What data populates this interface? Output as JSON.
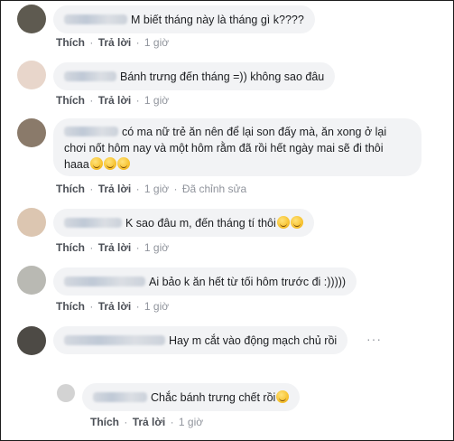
{
  "actions": {
    "like": "Thích",
    "reply": "Trả lời",
    "separator": "·"
  },
  "comments": [
    {
      "text": "M biết tháng này là tháng gì k????",
      "time": "1 giờ",
      "edited": ""
    },
    {
      "text": "Bánh trưng đến tháng =)) không sao đâu",
      "time": "1 giờ",
      "edited": ""
    },
    {
      "text": "có ma nữ trẻ ăn nên để lại son đấy mà, ăn xong ở lại chơi nốt hôm nay và một hôm rằm đã rồi hết ngày mai sẽ đi thôi haaa",
      "time": "1 giờ",
      "edited": "Đã chỉnh sửa"
    },
    {
      "text": "K sao đâu m, đến tháng tí thôi",
      "time": "1 giờ",
      "edited": ""
    },
    {
      "text": "Ai bảo k ăn hết từ tối hôm trước đi :)))))",
      "time": "1 giờ",
      "edited": ""
    },
    {
      "text": "Hay m cắt vào động mạch chủ rồi",
      "time": "",
      "edited": ""
    },
    {
      "text": "Chắc bánh trưng chết rồi",
      "time": "1 giờ",
      "edited": ""
    }
  ],
  "more_icon": "ellipsis-icon",
  "emoji_icons": [
    "rofl-emoji-icon",
    "pensive-emoji-icon"
  ]
}
